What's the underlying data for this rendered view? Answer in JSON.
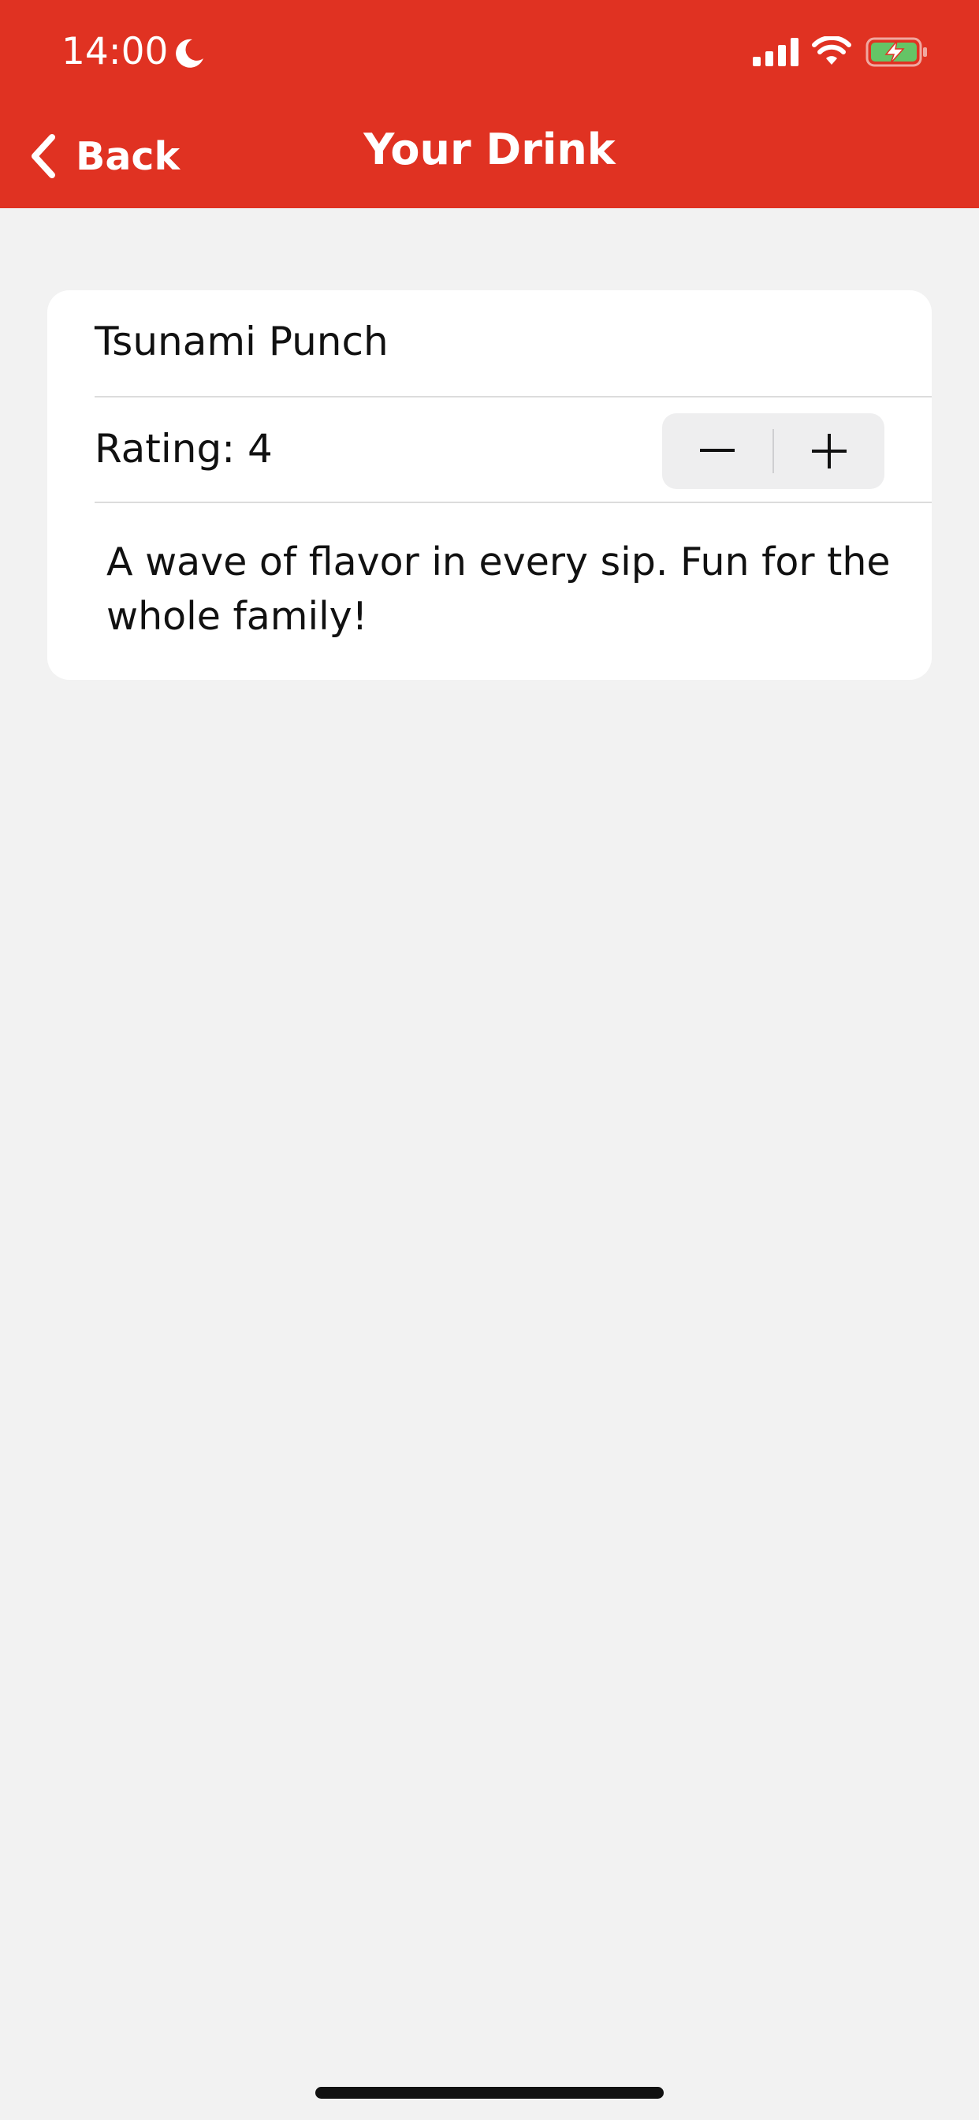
{
  "status_bar": {
    "time": "14:00",
    "icons": [
      "moon-icon",
      "signal-icon",
      "wifi-icon",
      "battery-charging-icon"
    ]
  },
  "nav": {
    "back_label": "Back",
    "title": "Your Drink",
    "back_icon": "chevron-left-icon"
  },
  "drink": {
    "name": "Tsunami Punch",
    "rating_label": "Rating: 4",
    "description": "A wave of flavor in every sip. Fun for the whole family!"
  },
  "stepper": {
    "decrement_icon": "minus-icon",
    "increment_icon": "plus-icon"
  },
  "colors": {
    "accent": "#e03222",
    "background": "#f2f2f2",
    "card": "#ffffff",
    "battery_fill": "#65c466"
  }
}
